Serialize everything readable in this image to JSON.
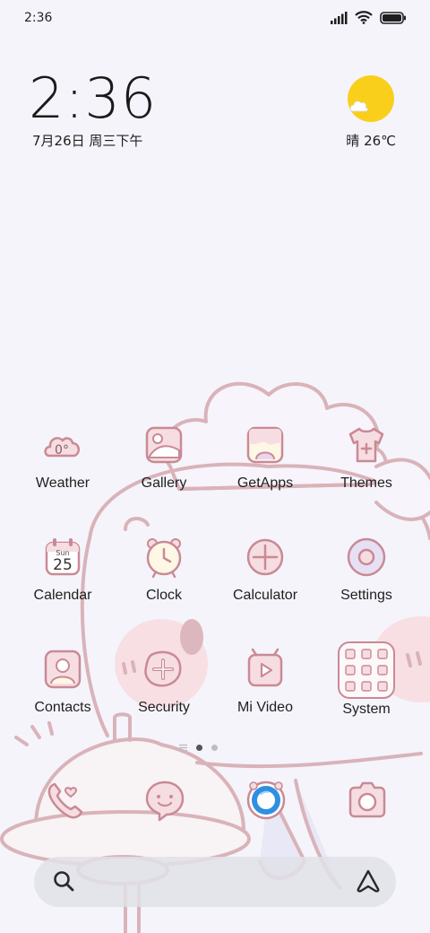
{
  "status_bar": {
    "time": "2:36",
    "icons": [
      "signal-icon",
      "wifi-icon",
      "battery-icon"
    ]
  },
  "clock_widget": {
    "time": "2:36",
    "date": "7月26日 周三下午"
  },
  "weather_widget": {
    "condition_temp": "晴 26℃",
    "icon": "sun-cloud-icon"
  },
  "apps": [
    {
      "label": "Weather",
      "icon": "weather-icon",
      "icon_text": "0°"
    },
    {
      "label": "Gallery",
      "icon": "gallery-icon"
    },
    {
      "label": "GetApps",
      "icon": "getapps-icon"
    },
    {
      "label": "Themes",
      "icon": "themes-icon"
    },
    {
      "label": "Calendar",
      "icon": "calendar-icon",
      "icon_day": "Sun",
      "icon_date": "25"
    },
    {
      "label": "Clock",
      "icon": "clock-icon"
    },
    {
      "label": "Calculator",
      "icon": "calculator-icon"
    },
    {
      "label": "Settings",
      "icon": "settings-icon"
    },
    {
      "label": "Contacts",
      "icon": "contacts-icon"
    },
    {
      "label": "Security",
      "icon": "security-icon"
    },
    {
      "label": "Mi Video",
      "icon": "mivideo-icon"
    },
    {
      "label": "System",
      "icon": "system-folder-icon"
    }
  ],
  "page_indicator": {
    "pages": 2,
    "current": 1
  },
  "dock": [
    "phone-icon",
    "messages-icon",
    "browser-icon",
    "camera-icon"
  ],
  "search_bar": {
    "left_icon": "search-icon",
    "right_icon": "assistant-icon"
  },
  "colors": {
    "icon_stroke": "#c98a95",
    "icon_fill": "#f6dde1",
    "background": "#f5f4fb",
    "sun": "#f9cf1c"
  }
}
